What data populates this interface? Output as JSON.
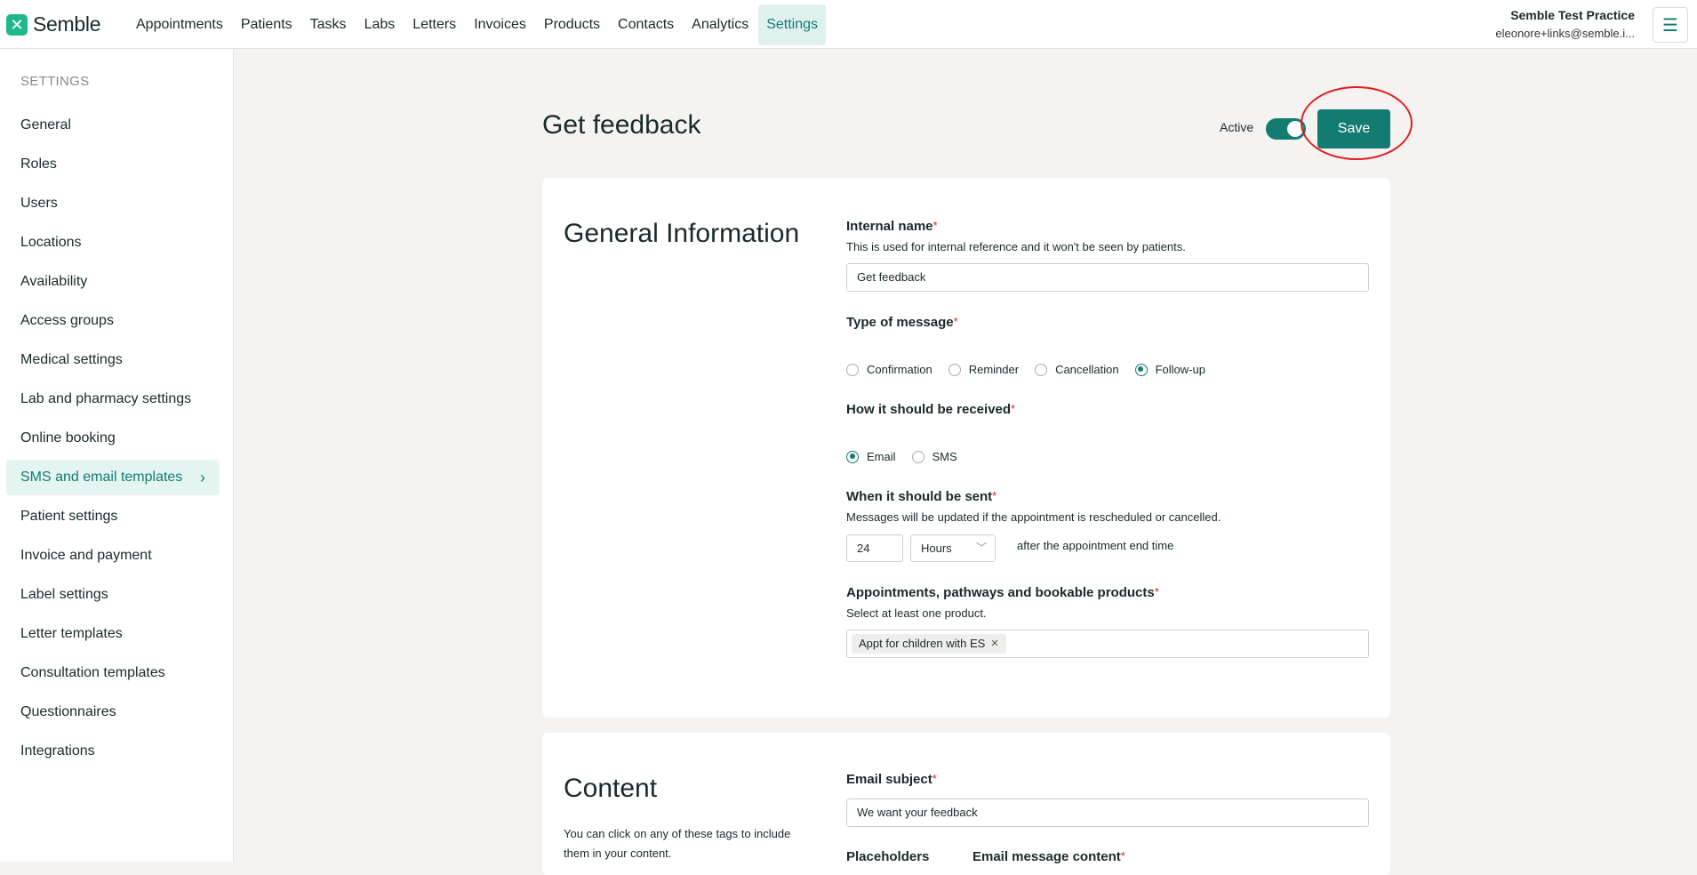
{
  "app": {
    "logo_text": "Semble",
    "nav": [
      "Appointments",
      "Patients",
      "Tasks",
      "Labs",
      "Letters",
      "Invoices",
      "Products",
      "Contacts",
      "Analytics",
      "Settings"
    ],
    "active_nav": "Settings",
    "account_name": "Semble Test Practice",
    "account_email": "eleonore+links@semble.i..."
  },
  "sidebar": {
    "heading": "SETTINGS",
    "items": [
      {
        "label": "General"
      },
      {
        "label": "Roles"
      },
      {
        "label": "Users"
      },
      {
        "label": "Locations"
      },
      {
        "label": "Availability"
      },
      {
        "label": "Access groups"
      },
      {
        "label": "Medical settings"
      },
      {
        "label": "Lab and pharmacy settings"
      },
      {
        "label": "Online booking"
      },
      {
        "label": "SMS and email templates",
        "active": true
      },
      {
        "label": "Patient settings"
      },
      {
        "label": "Invoice and payment"
      },
      {
        "label": "Label settings"
      },
      {
        "label": "Letter templates"
      },
      {
        "label": "Consultation templates"
      },
      {
        "label": "Questionnaires"
      },
      {
        "label": "Integrations"
      }
    ]
  },
  "header": {
    "title": "Get feedback",
    "active_label": "Active",
    "active_on": true,
    "save_label": "Save"
  },
  "general": {
    "title": "General Information",
    "internal_name": {
      "label": "Internal name",
      "hint": "This is used for internal reference and it won't be seen by patients.",
      "value": "Get feedback"
    },
    "type": {
      "label": "Type of message",
      "options": [
        "Confirmation",
        "Reminder",
        "Cancellation",
        "Follow-up"
      ],
      "selected": "Follow-up"
    },
    "received": {
      "label": "How it should be received",
      "options": [
        "Email",
        "SMS"
      ],
      "selected": "Email"
    },
    "when": {
      "label": "When it should be sent",
      "hint": "Messages will be updated if the appointment is rescheduled or cancelled.",
      "amount": "24",
      "unit": "Hours",
      "after_text": "after the appointment end time"
    },
    "products": {
      "label": "Appointments, pathways and bookable products",
      "hint": "Select at least one product.",
      "tags": [
        "Appt for children with ES"
      ]
    }
  },
  "content": {
    "title": "Content",
    "description": "You can click on any of these tags to include them in your content.",
    "email_subject_label": "Email subject",
    "email_subject_value": "We want your feedback",
    "placeholders_label": "Placeholders",
    "message_label": "Email message content"
  },
  "colors": {
    "accent": "#137b72",
    "required": "#e11d1d",
    "highlight_ring": "#e11d1d"
  },
  "icons": {
    "logo": "semble-logo-icon",
    "menu": "hamburger-menu-icon",
    "chevron": "chevron-right-icon",
    "remove": "close-icon",
    "dropdown": "chevron-down-icon"
  }
}
